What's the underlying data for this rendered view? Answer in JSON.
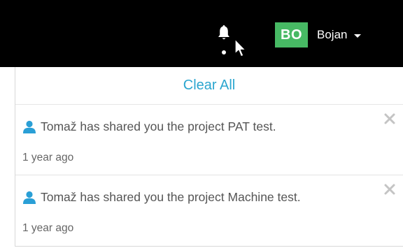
{
  "header": {
    "user": {
      "initials": "BO",
      "name": "Bojan",
      "avatar_color": "#47b964"
    },
    "notification_icon": "bell-icon"
  },
  "notifications_panel": {
    "clear_all_label": "Clear All",
    "accent_color": "#2ba6cf",
    "items": [
      {
        "icon": "user-icon",
        "message": "Tomaž has shared you the project PAT test.",
        "time": "1 year ago"
      },
      {
        "icon": "user-icon",
        "message": "Tomaž has shared you the project Machine test.",
        "time": "1 year ago"
      }
    ]
  }
}
